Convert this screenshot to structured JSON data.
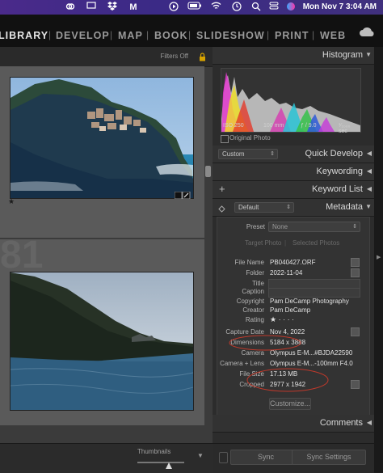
{
  "menubar": {
    "datetime": "Mon Nov 7  3:04 AM",
    "status_icons": [
      "creative-cloud-icon",
      "screen-share-icon",
      "dropbox-icon",
      "m-icon",
      "play-icon",
      "battery-icon",
      "wifi-icon",
      "clock-icon",
      "search-icon",
      "control-center-icon",
      "siri-icon"
    ]
  },
  "modules": {
    "items": [
      "LIBRARY",
      "DEVELOP",
      "MAP",
      "BOOK",
      "SLIDESHOW",
      "PRINT",
      "WEB"
    ],
    "active": "LIBRARY"
  },
  "grid": {
    "filters_label": "Filters Off",
    "cells": [
      {
        "number": "",
        "badge_star": "★"
      },
      {
        "number": "81",
        "badge_star": ""
      }
    ],
    "toolbar": {
      "thumbnails_label": "Thumbnails"
    }
  },
  "histogram": {
    "title": "Histogram",
    "iso": "ISO 250",
    "focal": "100 mm",
    "aperture": "ƒ / 9.0",
    "shutter": "¹⁄₁₀₀₀ sec",
    "original_photo_label": "Original Photo"
  },
  "quick_develop": {
    "title": "Quick Develop",
    "preset": "Custom"
  },
  "keywording": {
    "title": "Keywording"
  },
  "keyword_list": {
    "title": "Keyword List",
    "plus": "+"
  },
  "metadata": {
    "title": "Metadata",
    "preset_dropdown": "Default",
    "preset_label": "Preset",
    "preset_value": "None",
    "target_photo": "Target Photo",
    "selected_photos": "Selected Photos",
    "fields": [
      {
        "label": "File Name",
        "value": "PB040427.ORF"
      },
      {
        "label": "Folder",
        "value": "2022-11-04"
      },
      {
        "label": "Title",
        "value": ""
      },
      {
        "label": "Caption",
        "value": ""
      },
      {
        "label": "Copyright",
        "value": "Pam DeCamp Photography"
      },
      {
        "label": "Creator",
        "value": "Pam DeCamp"
      },
      {
        "label": "Rating",
        "value": "★  ·  ·  ·  ·"
      },
      {
        "label": "Capture Date",
        "value": "Nov 4, 2022"
      },
      {
        "label": "Dimensions",
        "value": "5184 x 3888"
      },
      {
        "label": "Camera",
        "value": "Olympus E-M...#BJDA22590"
      },
      {
        "label": "Camera + Lens",
        "value": "Olympus E-M...-100mm F4.0"
      },
      {
        "label": "File Size",
        "value": "17.13 MB"
      },
      {
        "label": "Cropped",
        "value": "2977 x 1942"
      }
    ],
    "customize_button": "Customize..."
  },
  "comments": {
    "title": "Comments"
  },
  "sync": {
    "sync_label": "Sync",
    "sync_settings_label": "Sync Settings"
  },
  "colors": {
    "annotation_red": "#c0392b",
    "active_module": "#e6e6e6"
  }
}
